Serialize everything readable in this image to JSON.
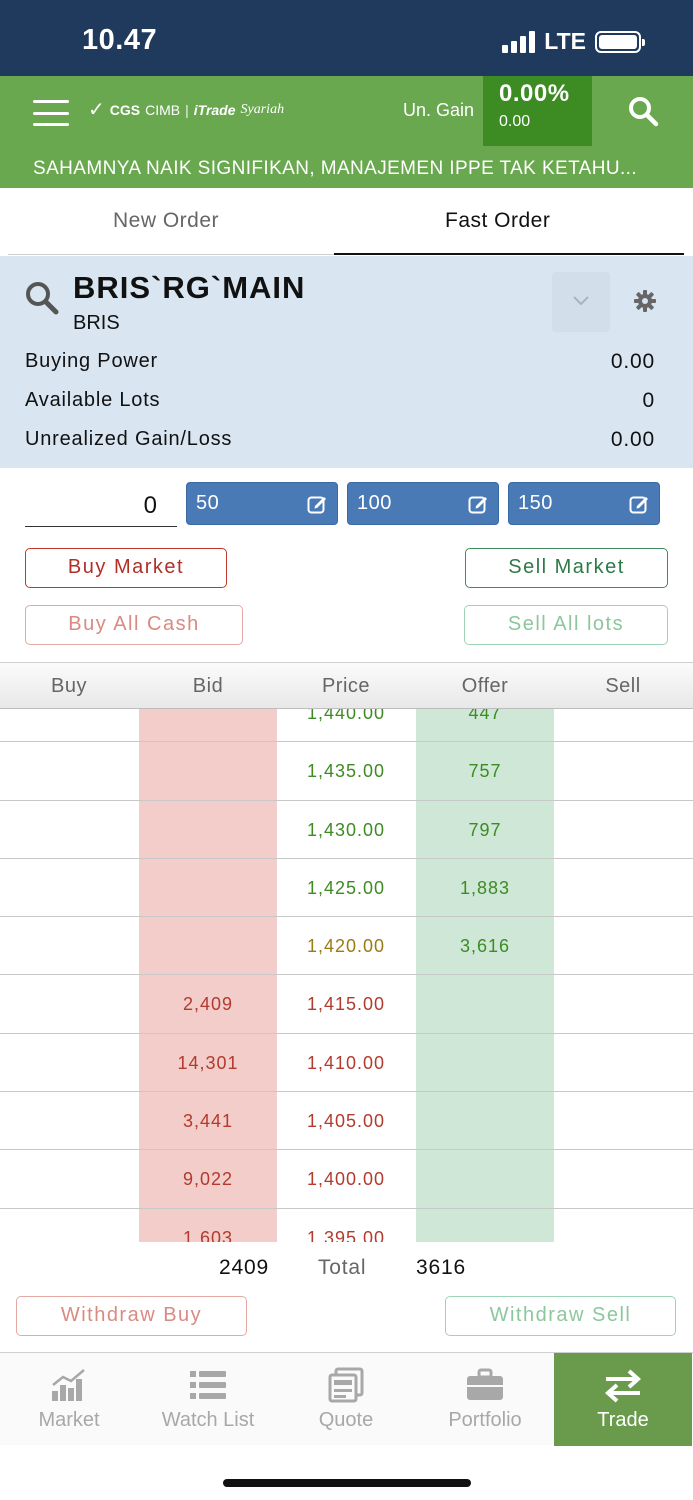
{
  "status_bar": {
    "time": "10.47",
    "network": "LTE"
  },
  "header": {
    "brand": {
      "cgs": "CGS",
      "cimb": "CIMB",
      "separator": "|",
      "itrade": "iTrade",
      "syariah": "Syariah"
    },
    "un_gain_label": "Un. Gain",
    "un_gain_percent": "0.00%",
    "un_gain_value": "0.00",
    "ticker_text": "SAHAMNYA NAIK SIGNIFIKAN, MANAJEMEN IPPE TAK KETAHU..."
  },
  "tabs": [
    {
      "label": "New Order",
      "active": false
    },
    {
      "label": "Fast Order",
      "active": true
    }
  ],
  "stock": {
    "code": "BRIS`RG`MAIN",
    "name": "BRIS",
    "info": [
      {
        "label": "Buying Power",
        "value": "0.00"
      },
      {
        "label": "Available Lots",
        "value": "0"
      },
      {
        "label": "Unrealized Gain/Loss",
        "value": "0.00"
      }
    ]
  },
  "lot": {
    "value": "0",
    "presets": [
      "50",
      "100",
      "150"
    ]
  },
  "actions": {
    "buy_market": "Buy Market",
    "sell_market": "Sell Market",
    "buy_all_cash": "Buy All Cash",
    "sell_all_lots": "Sell All lots"
  },
  "orderbook": {
    "columns": [
      "Buy",
      "Bid",
      "Price",
      "Offer",
      "Sell"
    ],
    "rows": [
      {
        "bid": "",
        "price": "1,440.00",
        "offer": "447",
        "trend": "up"
      },
      {
        "bid": "",
        "price": "1,435.00",
        "offer": "757",
        "trend": "up"
      },
      {
        "bid": "",
        "price": "1,430.00",
        "offer": "797",
        "trend": "up"
      },
      {
        "bid": "",
        "price": "1,425.00",
        "offer": "1,883",
        "trend": "up"
      },
      {
        "bid": "",
        "price": "1,420.00",
        "offer": "3,616",
        "trend": "open"
      },
      {
        "bid": "2,409",
        "price": "1,415.00",
        "offer": "",
        "trend": "down"
      },
      {
        "bid": "14,301",
        "price": "1,410.00",
        "offer": "",
        "trend": "down"
      },
      {
        "bid": "3,441",
        "price": "1,405.00",
        "offer": "",
        "trend": "down"
      },
      {
        "bid": "9,022",
        "price": "1,400.00",
        "offer": "",
        "trend": "down"
      },
      {
        "bid": "1,603",
        "price": "1,395.00",
        "offer": "",
        "trend": "down"
      }
    ],
    "total_bid": "2409",
    "total_label": "Total",
    "total_offer": "3616"
  },
  "withdraw": {
    "buy": "Withdraw Buy",
    "sell": "Withdraw Sell"
  },
  "nav": [
    {
      "label": "Market",
      "icon": "chart-icon",
      "active": false
    },
    {
      "label": "Watch List",
      "icon": "list-icon",
      "active": false
    },
    {
      "label": "Quote",
      "icon": "quote-icon",
      "active": false
    },
    {
      "label": "Portfolio",
      "icon": "briefcase-icon",
      "active": false
    },
    {
      "label": "Trade",
      "icon": "transfer-icon",
      "active": true
    }
  ],
  "colors": {
    "status_bar": "#1f3a5c",
    "header_green": "#6aa84f",
    "gain_box": "#3d8b23",
    "bid_bg": "#f2cdc9",
    "offer_bg": "#cfe7d6",
    "lot_button": "#4a7ab6",
    "nav_active": "#6a9a4c"
  }
}
